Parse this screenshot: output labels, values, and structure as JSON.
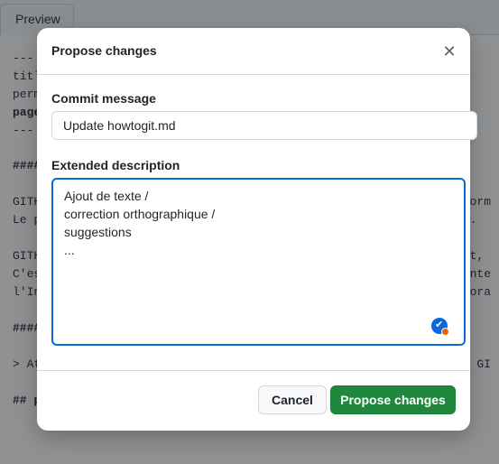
{
  "background": {
    "tab_label": "Preview",
    "lines": [
      {
        "text": "---"
      },
      {
        "text": "titl"
      },
      {
        "text": "perm"
      },
      {
        "text": "page"
      },
      {
        "text": "---"
      },
      {
        "text": "####"
      },
      {
        "text": "GITH",
        "right": "nform"
      },
      {
        "text": "Le p",
        "right": "rs."
      },
      {
        "text": "GITH",
        "right": "pot,"
      },
      {
        "text": "C'es",
        "right": "conte"
      },
      {
        "text": "l'In",
        "right": "abora"
      },
      {
        "text": "####"
      },
      {
        "text": "> At",
        "right": "ur GI"
      },
      {
        "text": "## p"
      }
    ]
  },
  "dialog": {
    "title": "Propose changes",
    "close_icon": "close-icon",
    "commit_label": "Commit message",
    "commit_value": "Update howtogit.md",
    "description_label": "Extended description",
    "description_value": "Ajout de texte /\ncorrection orthographique /\nsuggestions\n...",
    "cancel_label": "Cancel",
    "propose_label": "Propose changes"
  },
  "colors": {
    "primary_button": "#1f883d",
    "focus_border": "#0969da"
  }
}
